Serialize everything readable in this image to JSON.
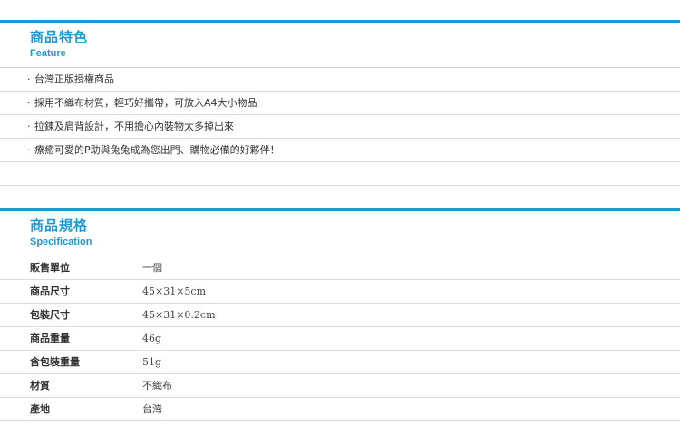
{
  "feature": {
    "title": "商品特色",
    "subtitle": "Feature",
    "bullet": "‧",
    "items": [
      "台灣正版授權商品",
      "採用不織布材質，輕巧好攜帶，可放入A4大小物品",
      "拉鍊及肩背設計，不用擔心內裝物太多掉出來",
      "療癒可愛的P助與兔兔成為您出門、購物必備的好夥伴！"
    ]
  },
  "spec": {
    "title": "商品規格",
    "subtitle": "Specification",
    "rows": [
      {
        "label": "販售單位",
        "value": "一個"
      },
      {
        "label": "商品尺寸",
        "value": "45×31×5cm"
      },
      {
        "label": "包裝尺寸",
        "value": "45×31×0.2cm"
      },
      {
        "label": "商品重量",
        "value": "46g"
      },
      {
        "label": "含包裝重量",
        "value": "51g"
      },
      {
        "label": "材質",
        "value": "不織布"
      },
      {
        "label": "產地",
        "value": "台灣"
      }
    ]
  },
  "colors": {
    "accent": "#1a9ad6",
    "divider": "#dcdcdc",
    "text": "#333333"
  }
}
